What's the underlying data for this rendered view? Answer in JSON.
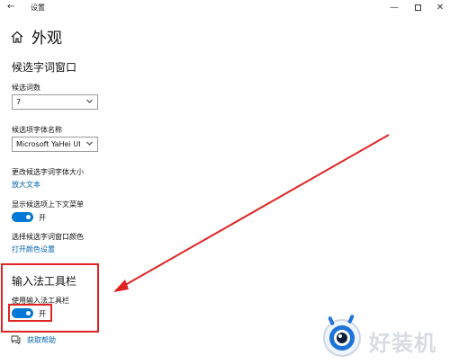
{
  "window": {
    "back_glyph": "←",
    "title": "设置",
    "minimize_glyph": "—",
    "close_glyph": "✕"
  },
  "header": {
    "icon": "home-icon",
    "title": "外观"
  },
  "candidate_window": {
    "section_title": "候选字词窗口",
    "count_label": "候选词数",
    "count_value": "7",
    "font_label": "候选项字体名称",
    "font_value": "Microsoft YaHei UI",
    "size_label": "更改候选字词字体大小",
    "size_link": "放大文本",
    "context_menu_label": "显示候选项上下文菜单",
    "context_menu_state": "开",
    "color_label": "选择候选字词窗口颜色",
    "color_link": "打开颜色设置"
  },
  "ime_toolbar": {
    "section_title": "输入法工具栏",
    "toggle_label": "使用输入法工具栏",
    "toggle_state": "开"
  },
  "help": {
    "icon": "help-icon",
    "link": "获取帮助"
  },
  "watermark": {
    "text": "好装机",
    "logo": "eye-logo"
  },
  "colors": {
    "accent": "#0078d7",
    "link": "#0063b1",
    "annotation_red": "#e02424"
  }
}
